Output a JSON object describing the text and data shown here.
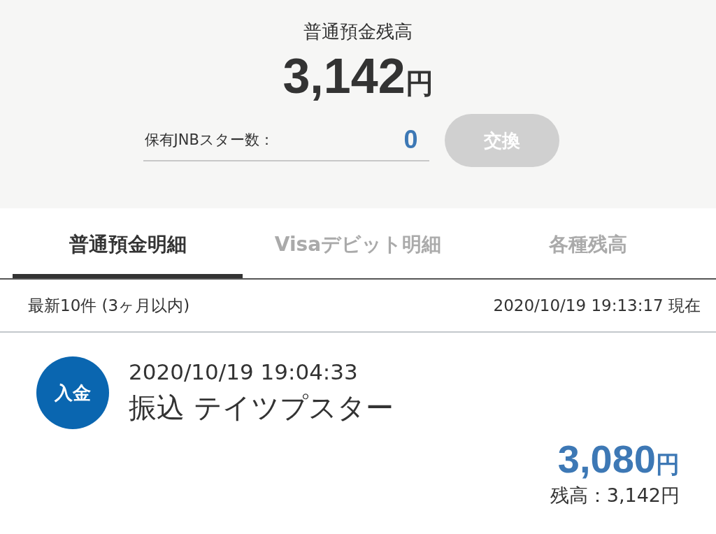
{
  "balance": {
    "title": "普通預金残高",
    "amount": "3,142",
    "unit": "円"
  },
  "stars": {
    "label": "保有JNBスター数：",
    "value": "0",
    "exchange_button": {
      "label": "交換",
      "disabled": true
    }
  },
  "tabs": [
    {
      "label": "普通預金明細",
      "selected": true
    },
    {
      "label": "Visaデビット明細",
      "selected": false
    },
    {
      "label": "各種残高",
      "selected": false
    }
  ],
  "list_header": {
    "summary": "最新10件 (3ヶ月以内)",
    "as_of": "2020/10/19 19:13:17 現在"
  },
  "transactions": [
    {
      "kind": "deposit",
      "badge": "入金",
      "datetime": "2020/10/19 19:04:33",
      "description": "振込 テイツプスター",
      "amount": "3,080",
      "unit": "円",
      "balance": "残高：3,142円"
    }
  ]
}
